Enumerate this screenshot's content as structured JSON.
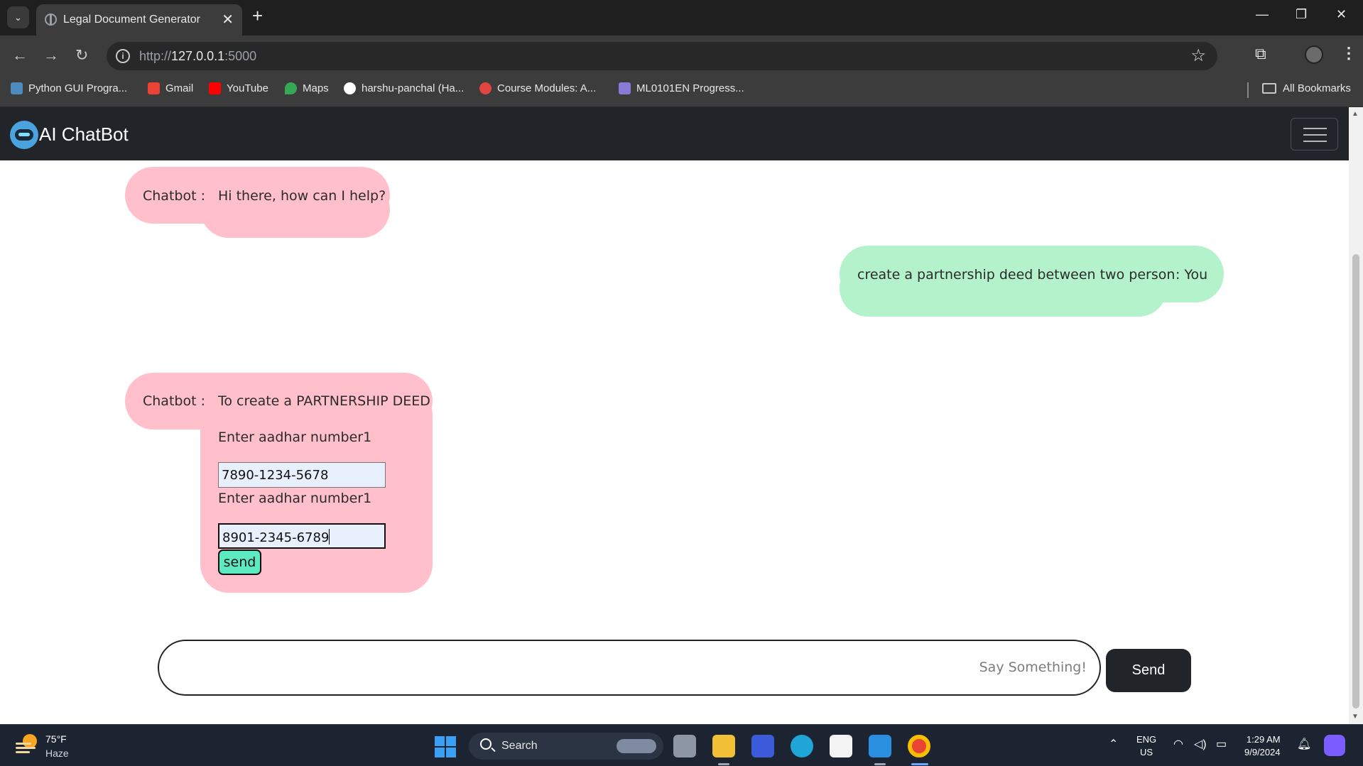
{
  "browser": {
    "tab_title": "Legal Document Generator",
    "url_scheme": "http://",
    "url_host": "127.0.0.1",
    "url_port": ":5000",
    "bookmarks": [
      {
        "label": "Python GUI Progra...",
        "icon_color": "#4b8bbe"
      },
      {
        "label": "Gmail",
        "icon_color": "#ea4335"
      },
      {
        "label": "YouTube",
        "icon_color": "#ff0000"
      },
      {
        "label": "Maps",
        "icon_color": "#34a853"
      },
      {
        "label": "harshu-panchal (Ha...",
        "icon_color": "#ffffff"
      },
      {
        "label": "Course Modules: A...",
        "icon_color": "#e0463f"
      },
      {
        "label": "ML0101EN Progress...",
        "icon_color": "#8a7ad8"
      }
    ],
    "all_bookmarks": "All Bookmarks"
  },
  "navbar": {
    "brand": "AI ChatBot"
  },
  "chat": {
    "messages": [
      {
        "sender": "Chatbot :",
        "text": "Hi there, how can I help?"
      },
      {
        "sender": ": You",
        "text": "create a partnership deed between two person"
      },
      {
        "sender": "Chatbot :",
        "text": "To create a PARTNERSHIP DEED"
      }
    ],
    "form": {
      "label1": "Enter aadhar number1",
      "value1": "7890-1234-5678",
      "label2": "Enter aadhar number1",
      "value2": "8901-2345-6789",
      "send_label": "send"
    },
    "input_placeholder": "Say Something!",
    "send_button": "Send"
  },
  "colors": {
    "bot_bubble": "#ffc0cb",
    "user_bubble": "#b4f2cc",
    "navbar": "#212529",
    "inline_send": "#5eeac0"
  },
  "taskbar": {
    "temperature": "75°F",
    "weather": "Haze",
    "search_label": "Search",
    "lang_top": "ENG",
    "lang_bottom": "US",
    "time": "1:29 AM",
    "date": "9/9/2024"
  }
}
